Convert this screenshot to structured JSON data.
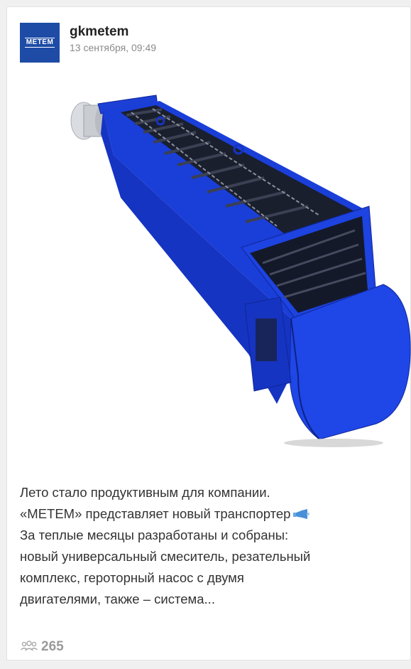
{
  "post": {
    "avatar_text": "METEM",
    "author": "gkmetem",
    "timestamp": "13 сентября, 09:49",
    "text_lines": [
      "Лето стало продуктивным для компании.",
      "«МЕТЕМ» представляет новый транспортер",
      "За теплые месяцы разработаны и собраны:",
      "новый универсальный смеситель, резательный",
      "комплекс, героторный насос с двумя",
      "двигателями, также – система..."
    ],
    "inline_icon": "megaphone-icon",
    "views_icon": "people-icon",
    "views_count": "265",
    "image_subject": "blue chain conveyor"
  },
  "colors": {
    "brand_blue": "#1d4ba6",
    "conveyor_blue": "#1c3fd6",
    "text": "#333333",
    "muted": "#8a8a8a"
  }
}
